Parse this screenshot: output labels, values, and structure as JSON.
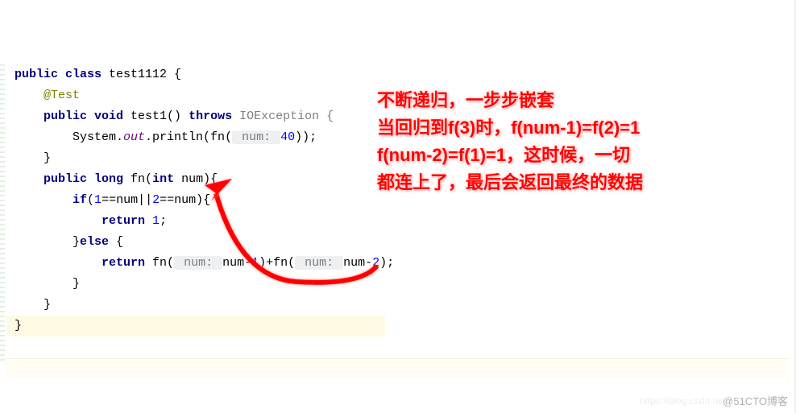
{
  "code": {
    "l1_kw1": "public class",
    "l1_name": " test1112 {",
    "l2_anno": "@Test",
    "l3_kw1": "public void",
    "l3_name": " test1() ",
    "l3_kw2": "throws",
    "l3_exc": " IOException {",
    "l4_pre": "System.",
    "l4_out": "out",
    "l4_post": ".println(fn(",
    "l4_hint": " num: ",
    "l4_val": "40",
    "l4_end": "));",
    "l5": "}",
    "l6_kw1": "public long",
    "l6_name": " fn(",
    "l6_kw2": "int",
    "l6_param": " num){",
    "l7_kw": "if",
    "l7_cond_a": "(",
    "l7_1a": "1",
    "l7_eq1": "==num||",
    "l7_2a": "2",
    "l7_eq2": "==num){",
    "l8_kw": "return ",
    "l8_val": "1",
    "l8_end": ";",
    "l9": "}",
    "l9_kw": "else",
    "l9_end": " {",
    "l10_kw": "return",
    "l10_a": " fn(",
    "l10_hint1": " num: ",
    "l10_b": "num-",
    "l10_1": "1",
    "l10_c": ")+fn(",
    "l10_hint2": " num: ",
    "l10_d": "num-",
    "l10_2": "2",
    "l10_e": ");",
    "l11": "}",
    "l12": "}",
    "l13": "}"
  },
  "annotation": {
    "line1": "不断递归，一步步嵌套",
    "line2": "当回归到f(3)时，f(num-1)=f(2)=1",
    "line3": "f(num-2)=f(1)=1，这时候，一切",
    "line4": "都连上了，最后会返回最终的数据"
  },
  "watermark": "@51CTO博客",
  "faint": "https://blog.csdn.ne"
}
